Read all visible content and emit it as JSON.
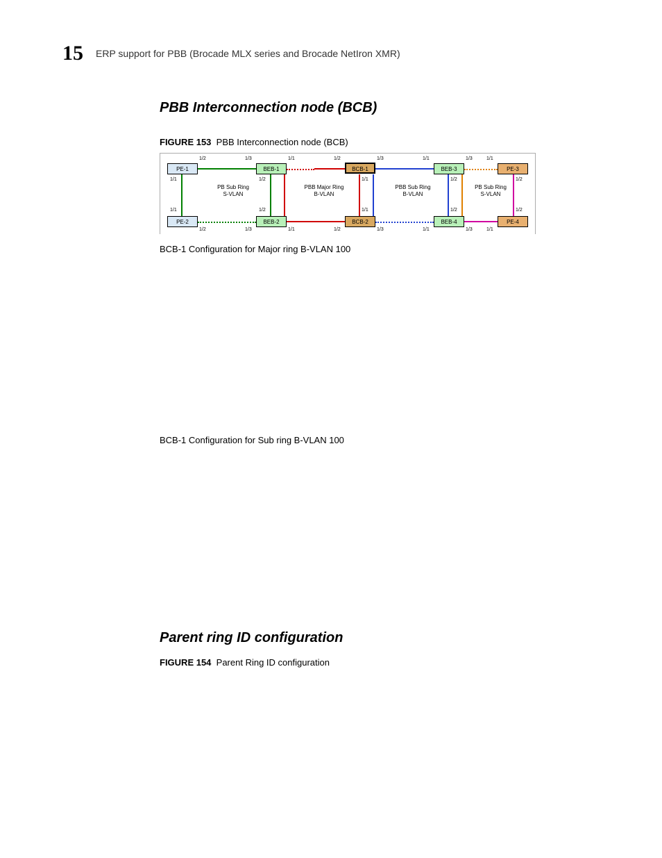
{
  "header": {
    "chapter_number": "15",
    "running_title": "ERP support for PBB (Brocade MLX series and Brocade NetIron XMR)"
  },
  "section1": {
    "heading": "PBB Interconnection node (BCB)",
    "figure_label": "FIGURE 153",
    "figure_caption": "PBB Interconnection node (BCB)",
    "caption_major": "BCB-1 Configuration for Major ring B-VLAN 100",
    "caption_sub": "BCB-1 Configuration for Sub ring B-VLAN 100"
  },
  "section2": {
    "heading": "Parent ring ID configuration",
    "figure_label": "FIGURE 154",
    "figure_caption": "Parent Ring ID configuration"
  },
  "diagram": {
    "nodes": {
      "pe1": "PE-1",
      "pe2": "PE-2",
      "pe3": "PE-3",
      "pe4": "PE-4",
      "beb1": "BEB-1",
      "beb2": "BEB-2",
      "beb3": "BEB-3",
      "beb4": "BEB-4",
      "bcb1": "BCB-1",
      "bcb2": "BCB-2"
    },
    "ring_labels": {
      "left_sub": "PB Sub Ring\nS-VLAN",
      "major": "PBB Major Ring\nB-VLAN",
      "mid_sub": "PBB Sub Ring\nB-VLAN",
      "right_sub": "PB Sub Ring\nS-VLAN"
    },
    "port_labels": {
      "p11": "1/1",
      "p12": "1/2",
      "p13": "1/3"
    }
  }
}
